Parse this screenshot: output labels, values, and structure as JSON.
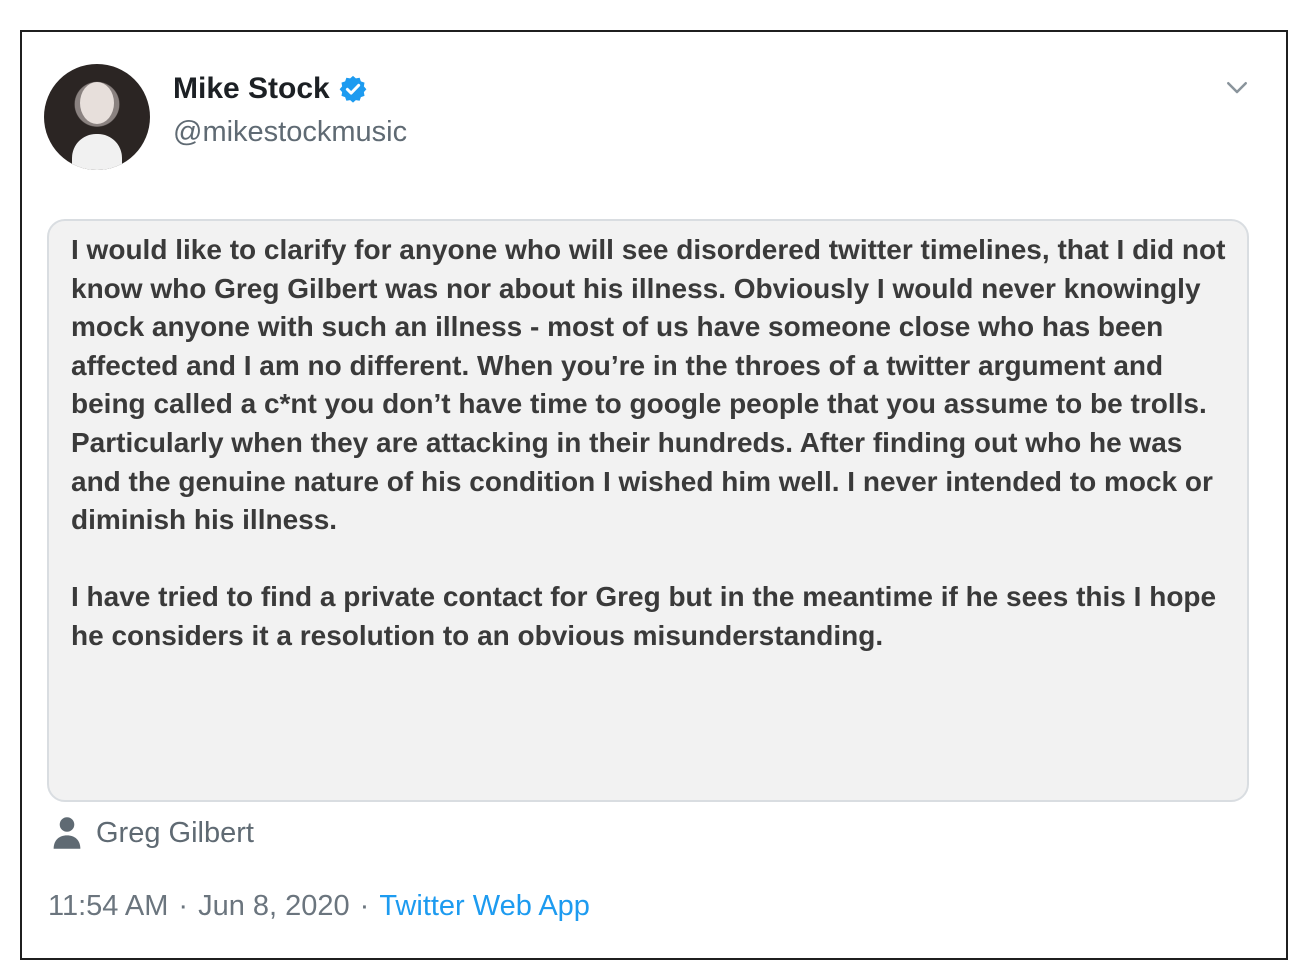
{
  "tweet": {
    "author_name": "Mike Stock",
    "author_handle": "@mikestockmusic",
    "icons": {
      "verified": "verified-badge-icon",
      "more": "chevron-down-icon",
      "tag": "person-icon"
    },
    "statement": "I would like to clarify for anyone who will see disordered twitter timelines, that I did not know who Greg Gilbert was nor about his illness. Obviously I would never knowingly mock anyone with such an illness - most of us have someone close who has been affected and I am no different. When you’re in the throes of a twitter argument and being called a c*nt you don’t have time to google people that you assume to be trolls. Particularly when they are attacking in their hundreds. After finding out who he was and the genuine nature of his condition I wished him well. I never intended to mock or diminish his illness.\n\nI have tried to find a private contact for Greg but in the meantime if he sees this I hope he considers it a resolution to an obvious misunderstanding.",
    "tagged_user": "Greg Gilbert",
    "time": "11:54 AM",
    "separator": "·",
    "date": "Jun 8, 2020",
    "source": "Twitter Web App"
  },
  "colors": {
    "accent": "#1d9bf0",
    "text": "#1c2024",
    "muted": "#5f6a73"
  }
}
